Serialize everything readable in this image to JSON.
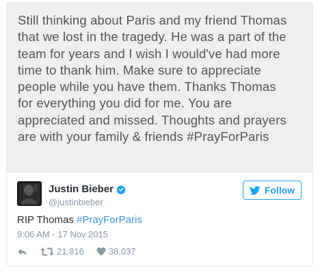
{
  "statement": {
    "text": "Still thinking about Paris and my friend Thomas\nthat we lost in the tragedy. He was a part of the\nteam for years and I wish I would've had more\ntime to thank him. Make sure to appreciate\npeople while you have them. Thanks Thomas\nfor everything you did for me. You are\nappreciated and missed. Thoughts and prayers\nare with your family & friends #PrayForParis"
  },
  "author": {
    "name": "Justin Bieber",
    "handle": "@justinbieber",
    "verified": true
  },
  "follow": {
    "label": "Follow",
    "icon": "twitter-bird-icon"
  },
  "tweet": {
    "text": "RIP Thomas ",
    "hashtag": "#PrayForParis",
    "timestamp": "9:06 AM - 17 Nov 2015"
  },
  "actions": {
    "retweets": "21,816",
    "likes": "38,037"
  },
  "colors": {
    "accent": "#1da1f2",
    "hashtag": "#3b94d9",
    "muted": "#8899a6",
    "text": "#292f33"
  }
}
